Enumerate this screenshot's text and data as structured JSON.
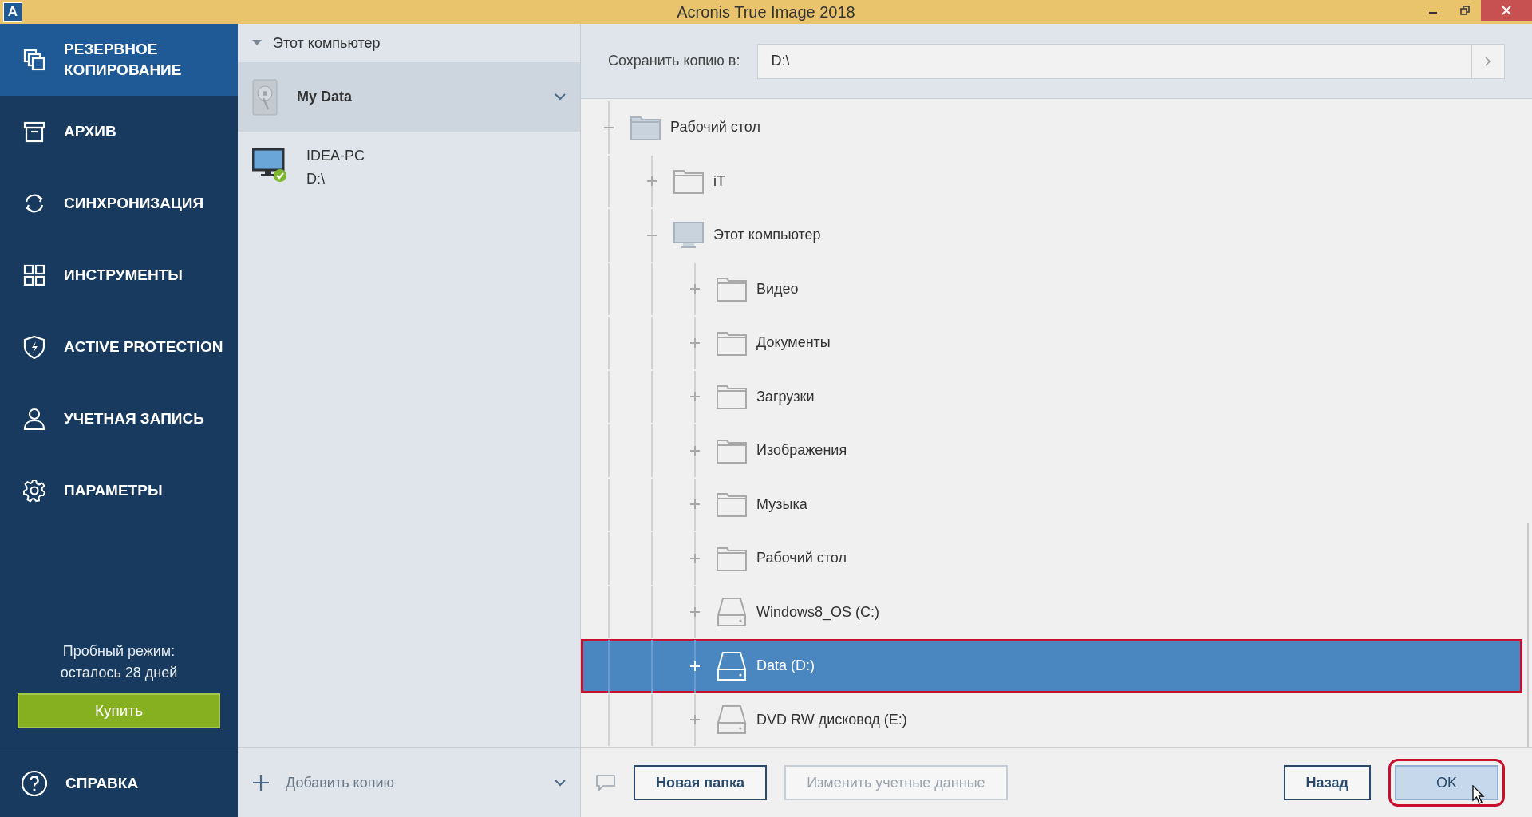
{
  "window": {
    "icon_letter": "A",
    "title": "Acronis True Image 2018"
  },
  "nav": {
    "items": [
      {
        "kind": "backup",
        "label": "РЕЗЕРВНОЕ КОПИРОВАНИЕ",
        "selected": true
      },
      {
        "kind": "archive",
        "label": "АРХИВ",
        "selected": false
      },
      {
        "kind": "sync",
        "label": "СИНХРОНИЗАЦИЯ",
        "selected": false
      },
      {
        "kind": "tools",
        "label": "ИНСТРУМЕНТЫ",
        "selected": false
      },
      {
        "kind": "protection",
        "label": "ACTIVE PROTECTION",
        "selected": false
      },
      {
        "kind": "account",
        "label": "УЧЕТНАЯ ЗАПИСЬ",
        "selected": false
      },
      {
        "kind": "settings",
        "label": "ПАРАМЕТРЫ",
        "selected": false
      }
    ],
    "trial_lines": [
      "Пробный режим:",
      "осталось 28 дней"
    ],
    "buy_label": "Купить",
    "help_label": "СПРАВКА"
  },
  "backups": {
    "header": "Этот компьютер",
    "expanded": true,
    "items": [
      {
        "kind": "source",
        "name": "My Data",
        "selected": true
      },
      {
        "kind": "destination",
        "name": "IDEA-PC",
        "path": "D:\\",
        "selected": false
      }
    ],
    "add_label": "Добавить копию"
  },
  "destination": {
    "label": "Сохранить копию в:",
    "value": "D:\\"
  },
  "tree": [
    {
      "kind": "desktop",
      "label": "Рабочий стол",
      "expanded": true,
      "selected": false,
      "children": [
        {
          "kind": "folder",
          "label": "iT",
          "expanded": false,
          "selected": false
        },
        {
          "kind": "computer",
          "label": "Этот компьютер",
          "expanded": true,
          "selected": false,
          "children": [
            {
              "kind": "folder",
              "label": "Видео",
              "expanded": false,
              "selected": false
            },
            {
              "kind": "folder",
              "label": "Документы",
              "expanded": false,
              "selected": false
            },
            {
              "kind": "folder",
              "label": "Загрузки",
              "expanded": false,
              "selected": false
            },
            {
              "kind": "folder",
              "label": "Изображения",
              "expanded": false,
              "selected": false
            },
            {
              "kind": "folder",
              "label": "Музыка",
              "expanded": false,
              "selected": false
            },
            {
              "kind": "folder",
              "label": "Рабочий стол",
              "expanded": false,
              "selected": false
            },
            {
              "kind": "drive",
              "label": "Windows8_OS (C:)",
              "expanded": false,
              "selected": false
            },
            {
              "kind": "drive",
              "label": "Data (D:)",
              "expanded": false,
              "selected": true,
              "annotated": true
            },
            {
              "kind": "drive",
              "label": "DVD RW дисковод (E:)",
              "expanded": false,
              "selected": false
            }
          ]
        }
      ]
    }
  ],
  "footer": {
    "left_buttons": [
      {
        "label": "Новая папка",
        "disabled": false,
        "default": false
      },
      {
        "label": "Изменить учетные данные",
        "disabled": true,
        "default": false
      }
    ],
    "right_buttons": [
      {
        "label": "Назад",
        "disabled": false,
        "default": false
      },
      {
        "label": "OK",
        "disabled": false,
        "default": true,
        "annotated": true
      }
    ]
  }
}
